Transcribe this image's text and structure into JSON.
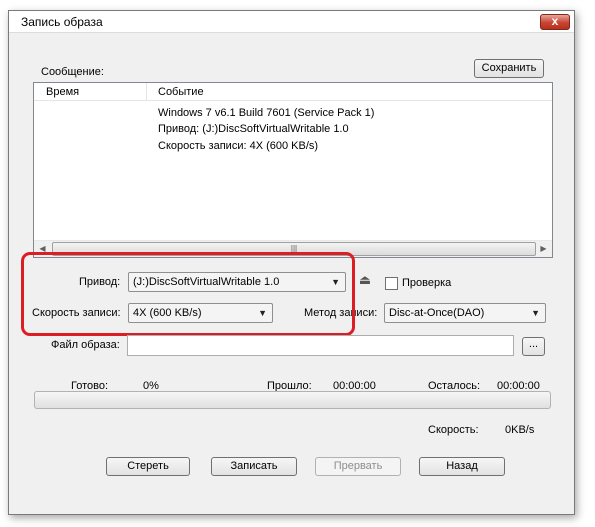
{
  "window": {
    "title": "Запись образа",
    "close_symbol": "x"
  },
  "messages": {
    "label": "Сообщение:",
    "save_button": "Сохранить",
    "columns": {
      "time": "Время",
      "event": "Событие"
    },
    "rows": [
      "Windows 7 v6.1 Build 7601 (Service Pack 1)",
      "Привод: (J:)DiscSoftVirtualWritable 1.0",
      "Скорость записи: 4X (600 KB/s)"
    ]
  },
  "settings": {
    "drive_label": "Привод:",
    "drive_value": "(J:)DiscSoftVirtualWritable 1.0",
    "verify_label": "Проверка",
    "verify_checked": false,
    "speed_label": "Скорость записи:",
    "speed_value": "4X (600 KB/s)",
    "method_label": "Метод записи:",
    "method_value": "Disc-at-Once(DAO)",
    "image_file_label": "Файл образа:",
    "image_file_value": "",
    "browse_button": "..."
  },
  "progress": {
    "ready_label": "Готово:",
    "ready_value": "0%",
    "elapsed_label": "Прошло:",
    "elapsed_value": "00:00:00",
    "remaining_label": "Осталось:",
    "remaining_value": "00:00:00",
    "fraction": 0,
    "speed_label": "Скорость:",
    "speed_value": "0KB/s"
  },
  "buttons": {
    "erase": "Стереть",
    "write": "Записать",
    "abort": "Прервать",
    "back": "Назад"
  },
  "icons": {
    "eject": "eject-icon",
    "scroll_left": "chevron-left-icon",
    "scroll_right": "chevron-right-icon",
    "dropdown": "chevron-down-icon"
  },
  "colors": {
    "highlight": "#dc1e24",
    "close_button": "#c84532"
  }
}
